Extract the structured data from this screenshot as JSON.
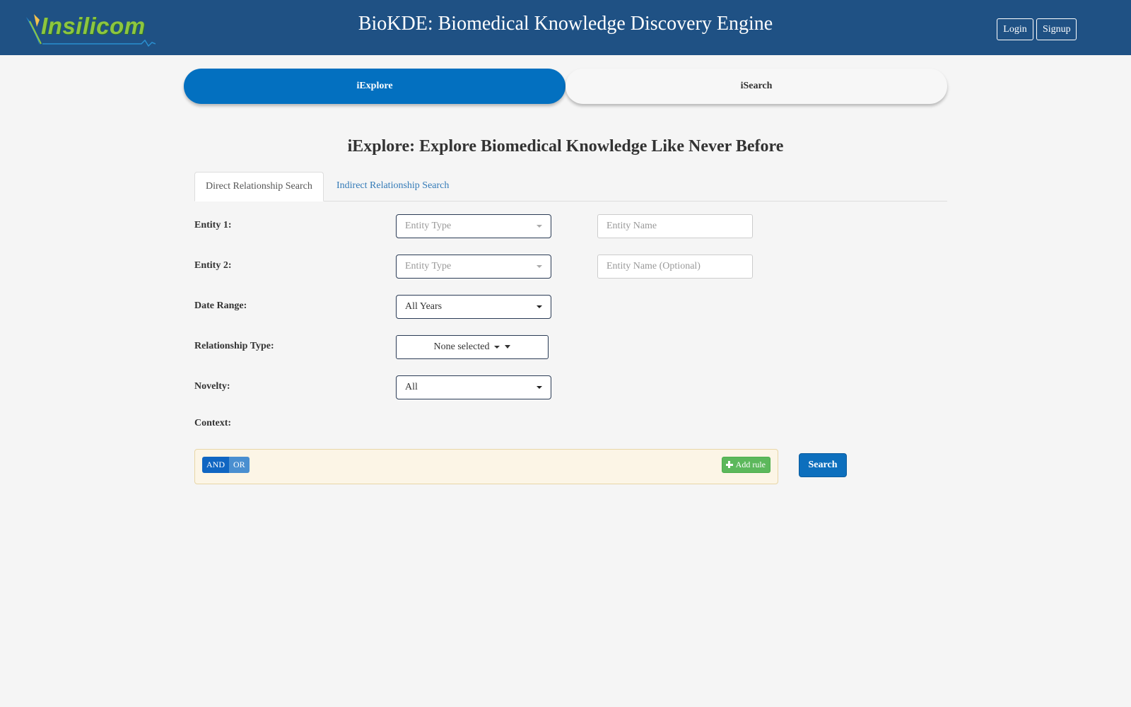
{
  "header": {
    "logo_text": "Insilicom",
    "title": "BioKDE: Biomedical Knowledge Discovery Engine",
    "login_label": "Login",
    "signup_label": "Signup"
  },
  "mode_tabs": [
    {
      "label": "iExplore",
      "active": true
    },
    {
      "label": "iSearch",
      "active": false
    }
  ],
  "page_heading": "iExplore: Explore Biomedical Knowledge Like Never Before",
  "subtabs": [
    {
      "label": "Direct Relationship Search",
      "active": true
    },
    {
      "label": "Indirect Relationship Search",
      "active": false
    }
  ],
  "form": {
    "entity1": {
      "label": "Entity 1:",
      "type_placeholder": "Entity Type",
      "name_placeholder": "Entity Name"
    },
    "entity2": {
      "label": "Entity 2:",
      "type_placeholder": "Entity Type",
      "name_placeholder": "Entity Name (Optional)"
    },
    "date_range": {
      "label": "Date Range:",
      "value": "All Years"
    },
    "relationship_type": {
      "label": "Relationship Type:",
      "value": "None selected"
    },
    "novelty": {
      "label": "Novelty:",
      "value": "All"
    },
    "context": {
      "label": "Context:"
    }
  },
  "query_builder": {
    "and_label": "AND",
    "or_label": "OR",
    "add_rule_label": "Add rule",
    "add_rule_icon": "plus-icon"
  },
  "search_label": "Search",
  "colors": {
    "header_bg": "#1f5184",
    "primary": "#0370c0",
    "add_rule_green": "#5cb85c",
    "rule_box_bg": "#fcf5e6"
  }
}
